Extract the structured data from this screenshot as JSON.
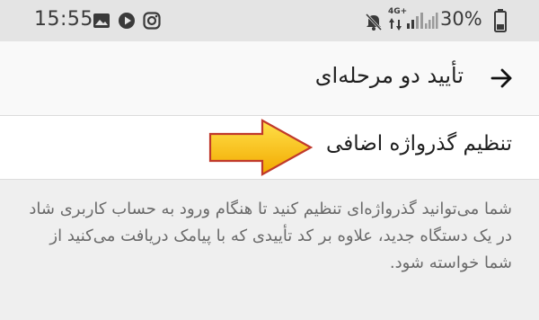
{
  "status_bar": {
    "time": "15:55",
    "network_label": "4G+",
    "battery_percent": "30%",
    "icons": [
      "image-icon",
      "play-icon",
      "instagram-icon",
      "mute-icon",
      "signal-icon",
      "signal-icon",
      "battery-icon"
    ]
  },
  "app_bar": {
    "title": "تأیید دو مرحله‌ای",
    "back_icon": "arrow-right-icon"
  },
  "settings_item": {
    "label": "تنظیم گذرواژه اضافی",
    "annotation": "arrow-pointer",
    "annotation_color": "#f7b500"
  },
  "description": "شما می‌توانید گذرواژه‌ای تنظیم کنید تا هنگام ورود به حساب کاربری شاد در یک دستگاه جدید، علاوه بر کد تأییدی که با پیامک دریافت می‌کنید از شما خواسته شود."
}
